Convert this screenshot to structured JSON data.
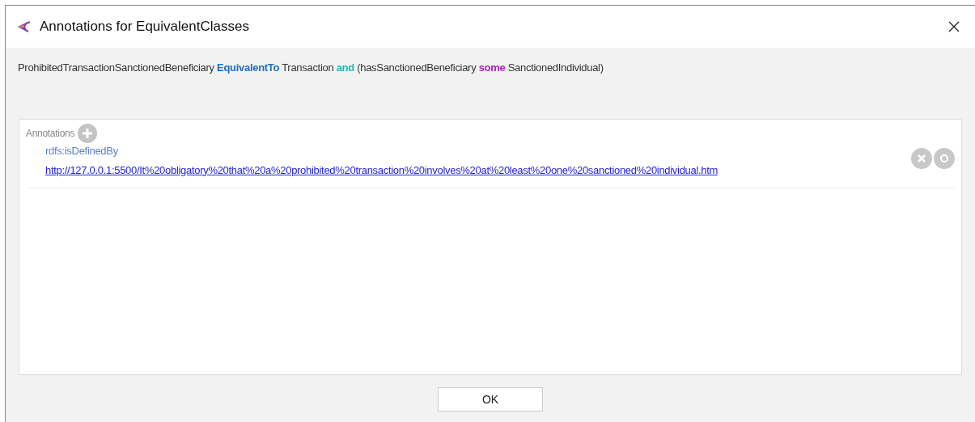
{
  "window": {
    "title": "Annotations for EquivalentClasses"
  },
  "expression": [
    {
      "kind": "plain",
      "text": "ProhibitedTransactionSanctionedBeneficiary"
    },
    {
      "kind": "keyword",
      "text": "EquivalentTo"
    },
    {
      "kind": "plain",
      "text": "Transaction"
    },
    {
      "kind": "operator",
      "text": "and"
    },
    {
      "kind": "plain",
      "text": "(hasSanctionedBeneficiary"
    },
    {
      "kind": "quantifier",
      "text": "some"
    },
    {
      "kind": "plain",
      "text": "SanctionedIndividual)"
    }
  ],
  "annotations": {
    "label": "Annotations",
    "items": [
      {
        "property": "rdfs:isDefinedBy",
        "value": "http://127.0.0.1:5500/It%20obligatory%20that%20a%20prohibited%20transaction%20involves%20at%20least%20one%20sanctioned%20individual.htm"
      }
    ]
  },
  "buttons": [
    "OK"
  ]
}
